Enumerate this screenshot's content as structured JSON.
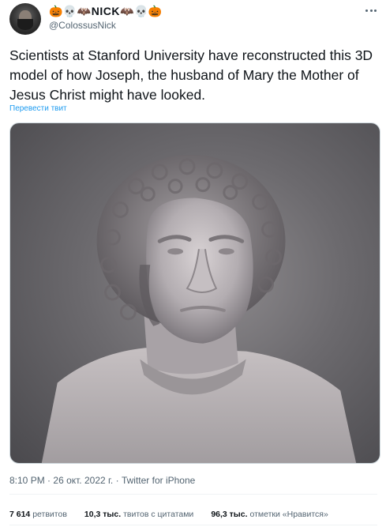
{
  "author": {
    "display_name": "🎃💀🦇NICK🦇💀🎃",
    "handle": "@ColossusNick"
  },
  "tweet": {
    "text": "Scientists at Stanford University have reconstructed this 3D model of how Joseph, the husband of Mary the Mother of Jesus Christ might have looked.",
    "translate_label": "Перевести твит"
  },
  "meta": {
    "time": "8:10 PM",
    "date": "26 окт. 2022 г.",
    "source": "Twitter for iPhone"
  },
  "stats": {
    "retweets_count": "7 614",
    "retweets_label": "ретвитов",
    "quotes_count": "10,3 тыс.",
    "quotes_label": "твитов с цитатами",
    "likes_count": "96,3 тыс.",
    "likes_label": "отметки «Нравится»"
  }
}
